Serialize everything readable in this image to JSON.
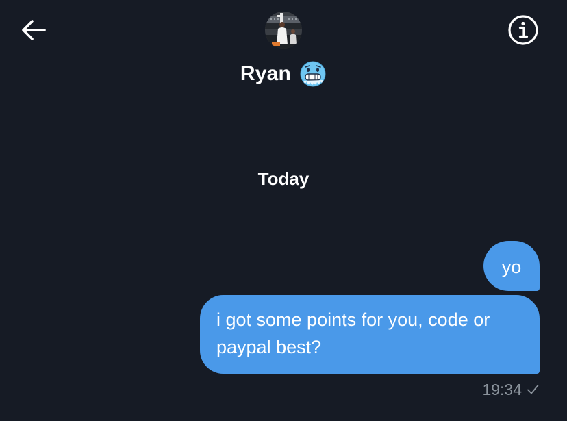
{
  "header": {
    "contact_name": "Ryan",
    "back_icon": "arrow-left-icon",
    "info_icon": "info-circle-icon",
    "status_emoji": "cold-face-emoji"
  },
  "conversation": {
    "date_separator": "Today",
    "messages": [
      {
        "text": "yo",
        "sender": "me"
      },
      {
        "text": "i got some points for you, code or paypal best?",
        "sender": "me"
      }
    ],
    "last_timestamp": "19:34",
    "status_icon": "checkmark-icon"
  },
  "colors": {
    "background": "#161b25",
    "bubble": "#4a99e9",
    "meta_text": "#8a929b"
  }
}
